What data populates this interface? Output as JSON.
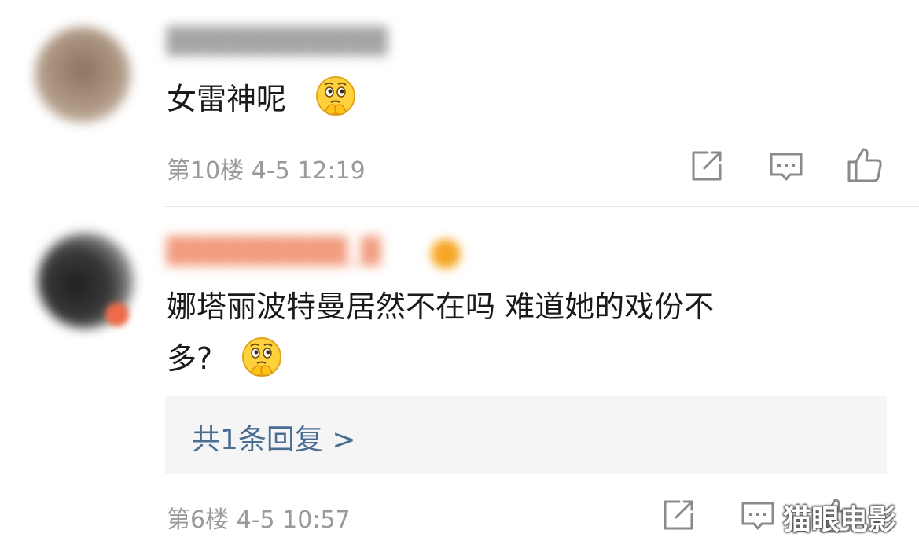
{
  "comments": [
    {
      "username": "███████████",
      "text": "女雷神呢",
      "emoji": "thinking-face-emoji",
      "floor": "第10楼",
      "time": "4-5 12:19"
    },
    {
      "username": "█████████_█",
      "text_line1": "娜塔丽波特曼居然不在吗 难道她的戏份不",
      "text_line2": "多?",
      "emoji": "thinking-face-emoji",
      "reply_link": "共1条回复 >",
      "floor": "第6楼",
      "time": "4-5 10:57"
    }
  ],
  "actions": [
    "share-icon",
    "comment-icon",
    "like-icon"
  ],
  "watermark": "猫眼电影",
  "colors": {
    "text": "#1a1a1a",
    "meta": "#9a9a9a",
    "link": "#4a6d92",
    "reply_bg": "#f5f5f6",
    "emoji_face": "#ffd23d"
  }
}
